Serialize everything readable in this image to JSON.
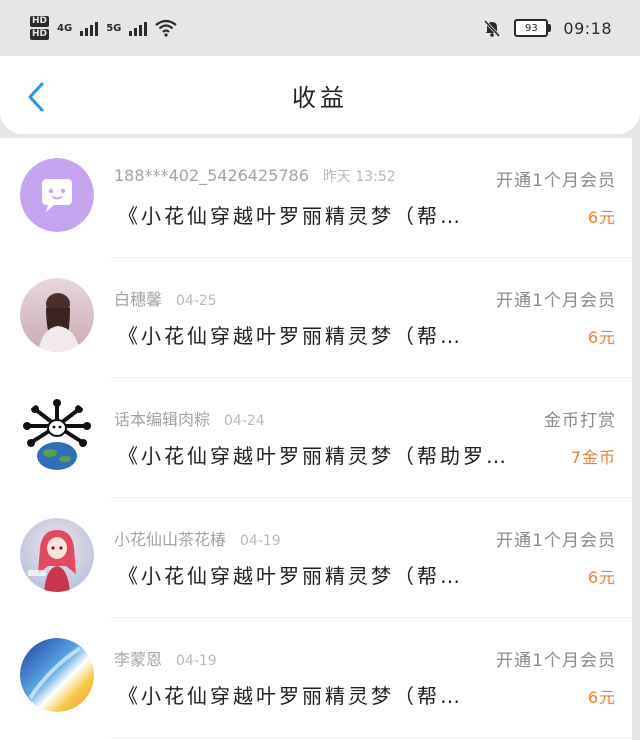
{
  "status_bar": {
    "hd_top": "HD",
    "hd_bottom": "HD",
    "net_1": "4G",
    "net_2": "5G",
    "battery": "93",
    "time": "09:18"
  },
  "header": {
    "title": "收益"
  },
  "colors": {
    "accent_blue": "#2196f3",
    "amount_orange": "#e8803a"
  },
  "records": [
    {
      "name": "188***402_5426425786",
      "date": "昨天 13:52",
      "type": "开通1个月会员",
      "book": "《小花仙穿越叶罗丽精灵梦（帮…",
      "amount": "6元",
      "avatar": "purple-chat-icon"
    },
    {
      "name": "白穗馨",
      "date": "04-25",
      "type": "开通1个月会员",
      "book": "《小花仙穿越叶罗丽精灵梦（帮…",
      "amount": "6元",
      "avatar": "girl-photo"
    },
    {
      "name": "话本编辑肉粽",
      "date": "04-24",
      "type": "金币打赏",
      "book": "《小花仙穿越叶罗丽精灵梦（帮助罗…",
      "amount": "7金币",
      "avatar": "cartoon-planet"
    },
    {
      "name": "小花仙山茶花椿",
      "date": "04-19",
      "type": "开通1个月会员",
      "book": "《小花仙穿越叶罗丽精灵梦（帮…",
      "amount": "6元",
      "avatar": "anime-girl"
    },
    {
      "name": "李蒙恩",
      "date": "04-19",
      "type": "开通1个月会员",
      "book": "《小花仙穿越叶罗丽精灵梦（帮…",
      "amount": "6元",
      "avatar": "abstract-gradient"
    }
  ]
}
